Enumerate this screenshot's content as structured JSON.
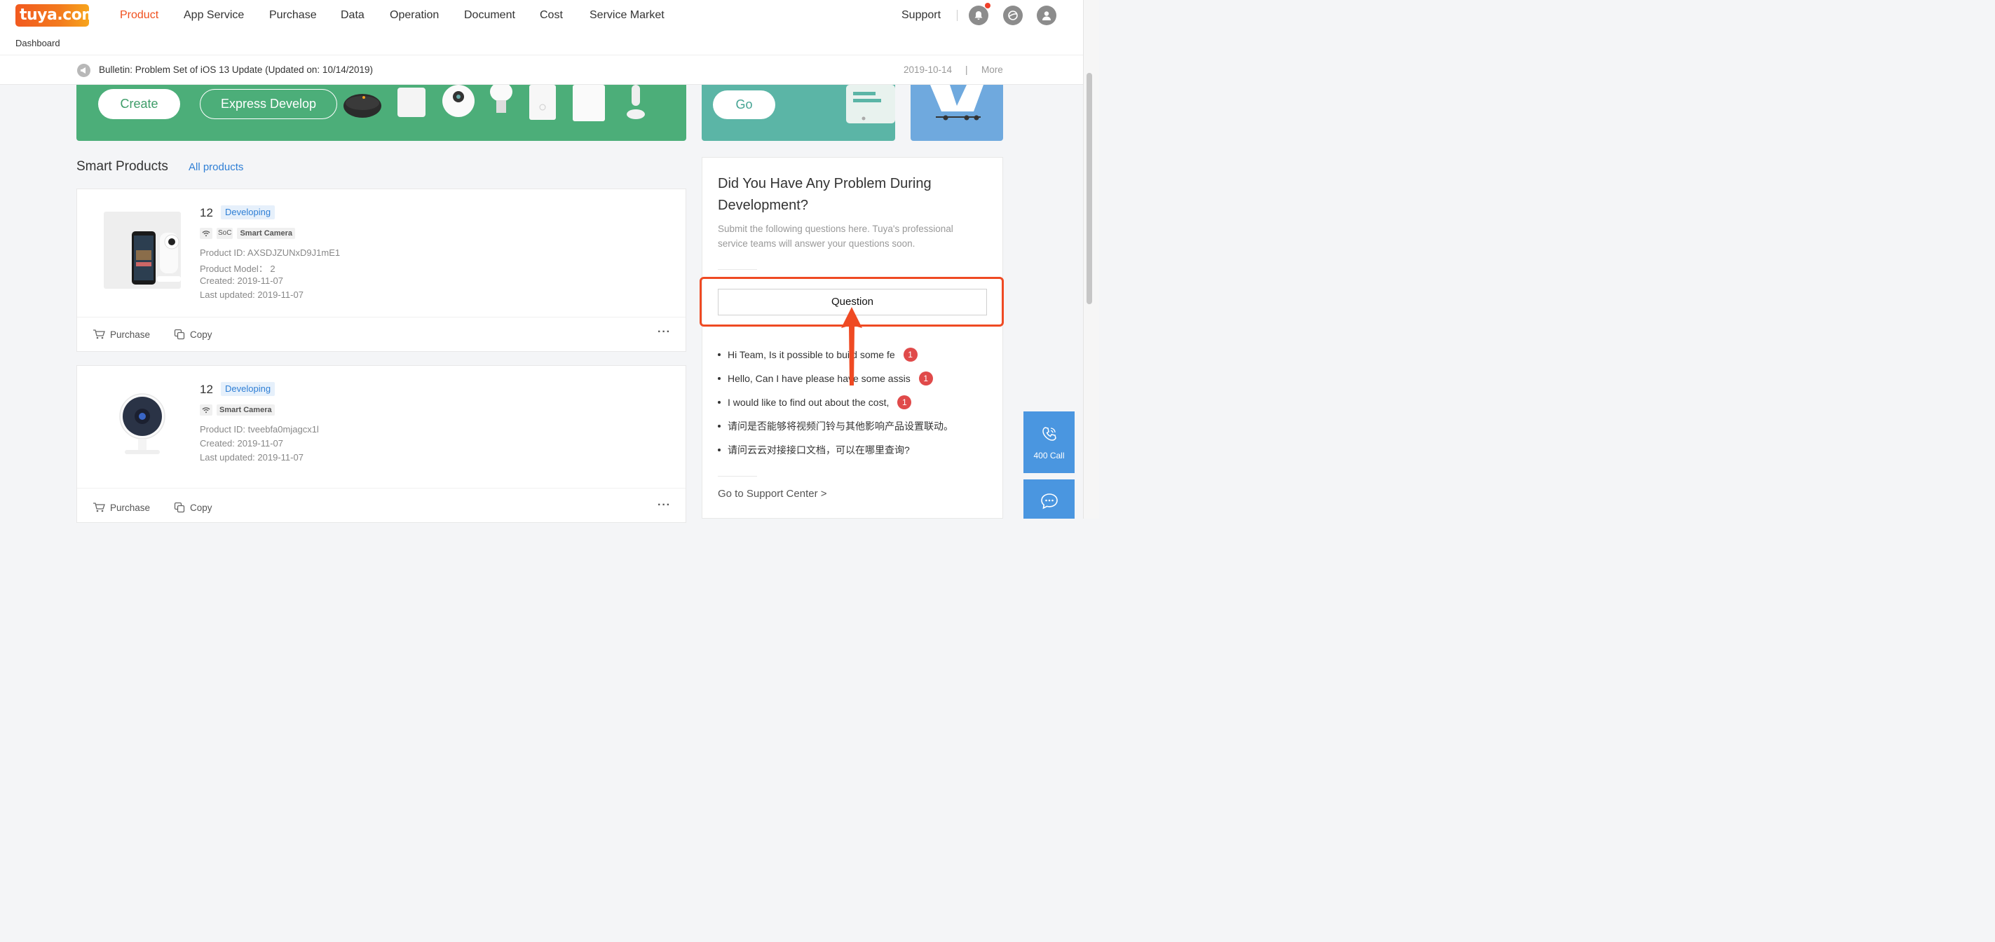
{
  "logo": {
    "text": "tuya.com"
  },
  "nav": {
    "items": [
      "Product",
      "App Service",
      "Purchase",
      "Data",
      "Operation",
      "Document",
      "Cost",
      "Service Market"
    ],
    "support": "Support",
    "breadcrumb": "Dashboard"
  },
  "bulletin": {
    "text": "Bulletin: Problem Set of iOS 13 Update (Updated on: 10/14/2019)",
    "date": "2019-10-14",
    "separator": "|",
    "more": "More"
  },
  "banners": {
    "create": "Create",
    "express": "Express Develop",
    "go": "Go"
  },
  "products": {
    "title": "Smart Products",
    "all_link": "All products",
    "cards": [
      {
        "name": "12",
        "status": "Developing",
        "tags": [
          "SoC",
          "Smart Camera"
        ],
        "product_id": "Product ID: AXSDJZUNxD9J1mE1",
        "model": "Product Model： 2",
        "created": "Created: 2019-11-07",
        "updated": "Last updated: 2019-11-07",
        "purchase": "Purchase",
        "copy": "Copy",
        "more": "···"
      },
      {
        "name": "12",
        "status": "Developing",
        "tags": [
          "Smart Camera"
        ],
        "product_id": "Product ID: tveebfa0mjagcx1l",
        "created": "Created: 2019-11-07",
        "updated": "Last updated: 2019-11-07",
        "purchase": "Purchase",
        "copy": "Copy",
        "more": "···"
      }
    ]
  },
  "problem": {
    "title": "Did You Have Any Problem During Development?",
    "desc": "Submit the following questions here. Tuya's professional service teams will answer your questions soon.",
    "button": "Question",
    "questions": [
      {
        "text": "Hi Team, Is it possible to build some fe",
        "count": "1"
      },
      {
        "text": "Hello, Can I have please have some assis",
        "count": "1"
      },
      {
        "text": "I would like to find out about the cost,",
        "count": "1"
      },
      {
        "text": "请问是否能够将视频门铃与其他影响产品设置联动。",
        "count": ""
      },
      {
        "text": "请问云云对接接口文档，可以在哪里查询?",
        "count": ""
      }
    ],
    "support_link": "Go to Support Center >"
  },
  "side": {
    "call": "400 Call"
  },
  "colors": {
    "brand": "#f0501e",
    "link": "#2f7fd5",
    "highlight": "#ef4a23",
    "green_banner": "#4cae79",
    "side_button": "#4a96e0"
  }
}
